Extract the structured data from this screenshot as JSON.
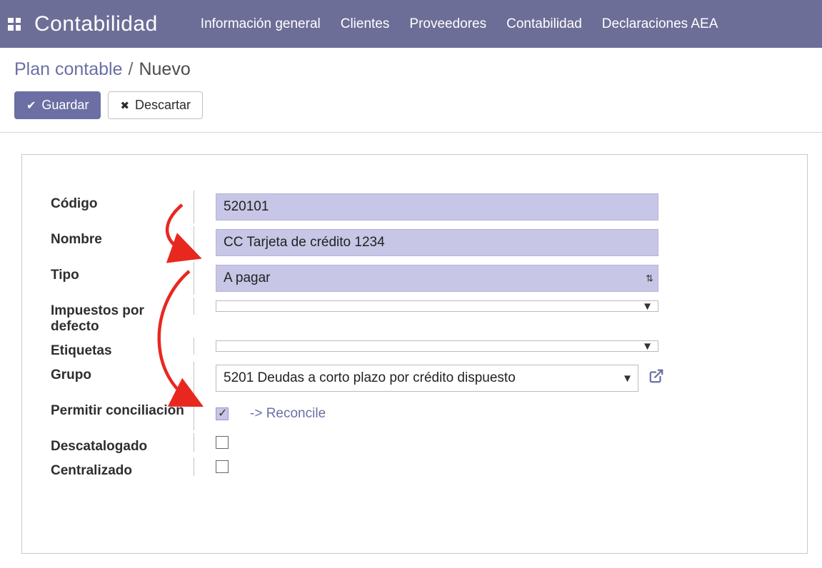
{
  "navbar": {
    "brand": "Contabilidad",
    "items": [
      "Información general",
      "Clientes",
      "Proveedores",
      "Contabilidad",
      "Declaraciones AEA"
    ]
  },
  "breadcrumb": {
    "parent": "Plan contable",
    "sep": "/",
    "current": "Nuevo"
  },
  "actions": {
    "save": "Guardar",
    "discard": "Descartar"
  },
  "form": {
    "codigo": {
      "label": "Código",
      "value": "520101"
    },
    "nombre": {
      "label": "Nombre",
      "value": "CC Tarjeta de crédito 1234"
    },
    "tipo": {
      "label": "Tipo",
      "value": "A pagar"
    },
    "impuestos": {
      "label": "Impuestos por defecto",
      "value": ""
    },
    "etiquetas": {
      "label": "Etiquetas",
      "value": ""
    },
    "grupo": {
      "label": "Grupo",
      "value": "5201 Deudas a corto plazo por crédito dispuesto"
    },
    "permitir": {
      "label": "Permitir conciliación",
      "checked": true,
      "link": "-> Reconcile"
    },
    "descatalogado": {
      "label": "Descatalogado",
      "checked": false
    },
    "centralizado": {
      "label": "Centralizado",
      "checked": false
    }
  }
}
